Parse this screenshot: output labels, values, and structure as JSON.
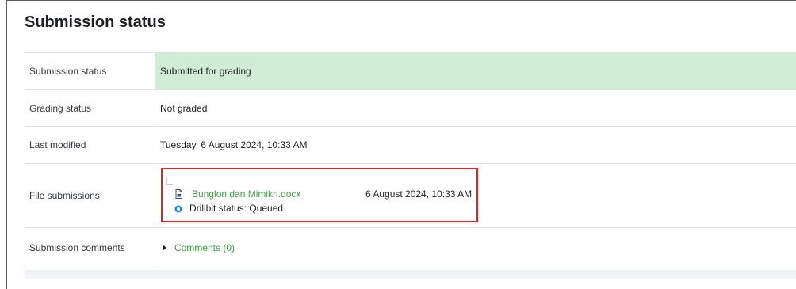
{
  "page_title": "Submission status",
  "rows": [
    {
      "label": "Submission status",
      "value": "Submitted for grading"
    },
    {
      "label": "Grading status",
      "value": "Not graded"
    },
    {
      "label": "Last modified",
      "value": "Tuesday, 6 August 2024, 10:33 AM"
    },
    {
      "label": "File submissions"
    },
    {
      "label": "Submission comments"
    }
  ],
  "file": {
    "name": "Bunglon dan Mimikri.docx",
    "date": "6 August 2024, 10:33 AM",
    "status": "Drillbit status: Queued"
  },
  "comments_link": "Comments (0)",
  "colors": {
    "submitted_bg": "#d0ecd4",
    "link": "#43a047",
    "highlight_box": "#e02424"
  },
  "icons": [
    "document-icon",
    "drillbit-icon",
    "expand-triangle-icon"
  ]
}
